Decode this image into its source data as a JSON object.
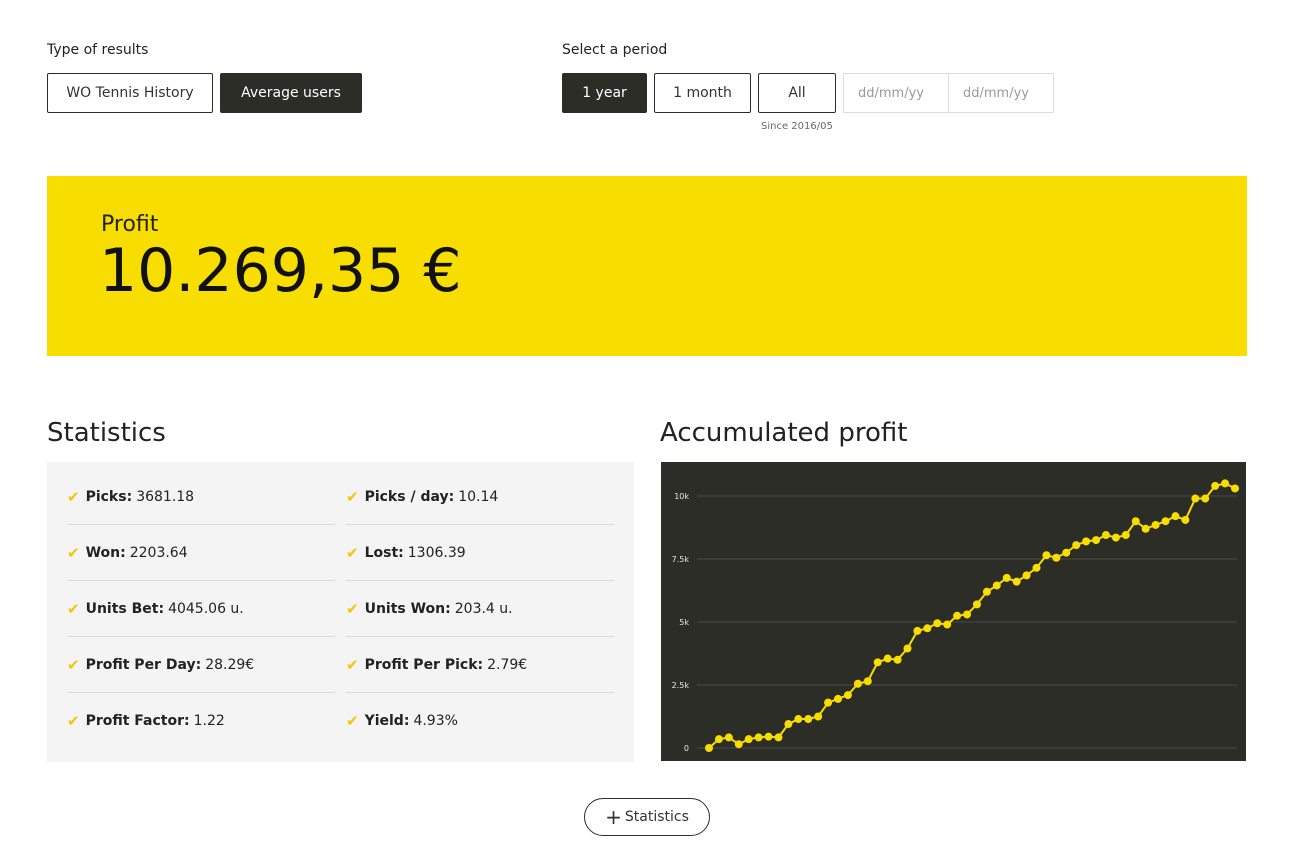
{
  "results_type": {
    "label": "Type of results",
    "options": [
      "WO Tennis History",
      "Average users"
    ],
    "selected": "Average users"
  },
  "period": {
    "label": "Select a period",
    "options": [
      "1 year",
      "1 month",
      "All"
    ],
    "selected": "1 year",
    "since_note": "Since 2016/05",
    "date_from_placeholder": "dd/mm/yy",
    "date_to_placeholder": "dd/mm/yy"
  },
  "profit": {
    "label": "Profit",
    "value": "10.269,35 €"
  },
  "statistics": {
    "title": "Statistics",
    "items": [
      {
        "label": "Picks:",
        "value": "3681.18"
      },
      {
        "label": "Picks / day:",
        "value": "10.14"
      },
      {
        "label": "Won:",
        "value": "2203.64"
      },
      {
        "label": "Lost:",
        "value": "1306.39"
      },
      {
        "label": "Units Bet:",
        "value": "4045.06 u."
      },
      {
        "label": "Units Won:",
        "value": "203.4 u."
      },
      {
        "label": "Profit Per Day:",
        "value": "28.29€"
      },
      {
        "label": "Profit Per Pick:",
        "value": "2.79€"
      },
      {
        "label": "Profit Factor:",
        "value": "1.22"
      },
      {
        "label": "Yield:",
        "value": "4.93%"
      }
    ],
    "check_glyph": "✔"
  },
  "accumulated": {
    "title": "Accumulated profit"
  },
  "more_button": {
    "label": "Statistics",
    "icon": "plus-icon"
  },
  "colors": {
    "accent": "#f8dd00",
    "dark": "#2d2d28",
    "panel": "#f3f4f3"
  },
  "chart_data": {
    "type": "line",
    "y_ticks": [
      "0",
      "2.5k",
      "5k",
      "7.5k",
      "10k"
    ],
    "ylim": [
      0,
      10000
    ],
    "grid": true,
    "legend": "none",
    "values": [
      0,
      350,
      420,
      150,
      350,
      420,
      450,
      420,
      950,
      1150,
      1150,
      1250,
      1800,
      1950,
      2100,
      2550,
      2650,
      3400,
      3550,
      3500,
      3950,
      4650,
      4750,
      4950,
      4900,
      5250,
      5300,
      5700,
      6200,
      6450,
      6750,
      6600,
      6850,
      7150,
      7650,
      7550,
      7750,
      8050,
      8200,
      8250,
      8450,
      8350,
      8450,
      9000,
      8700,
      8850,
      9000,
      9200,
      9050,
      9900,
      9900,
      10400,
      10500,
      10300
    ]
  }
}
